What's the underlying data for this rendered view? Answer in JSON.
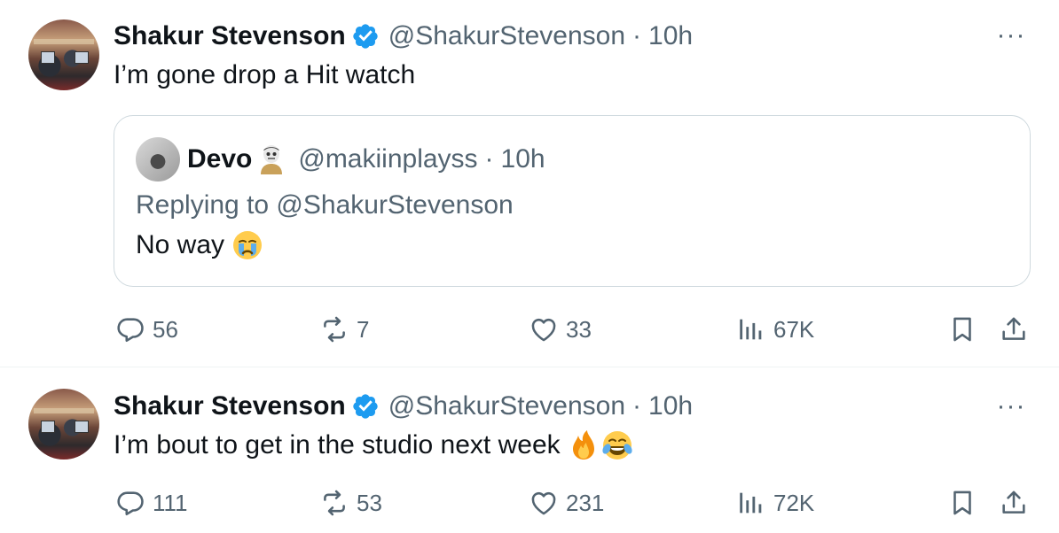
{
  "tweets": [
    {
      "author": {
        "name": "Shakur Stevenson",
        "handle": "@ShakurStevenson"
      },
      "separator": "·",
      "time": "10h",
      "text": "I’m gone drop a Hit watch",
      "more_label": "···",
      "quote": {
        "author": {
          "name": "Devo",
          "handle": "@makiinplayss"
        },
        "separator": "·",
        "time": "10h",
        "replying_to": "Replying to @ShakurStevenson",
        "text": "No way",
        "text_emoji": "loudly-crying-face"
      },
      "stats": {
        "replies": "56",
        "reposts": "7",
        "likes": "33",
        "views": "67K"
      }
    },
    {
      "author": {
        "name": "Shakur Stevenson",
        "handle": "@ShakurStevenson"
      },
      "separator": "·",
      "time": "10h",
      "text": "I’m bout to get in the studio next week",
      "text_emojis": [
        "fire",
        "face-with-tears-of-joy"
      ],
      "more_label": "···",
      "stats": {
        "replies": "111",
        "reposts": "53",
        "likes": "231",
        "views": "72K"
      }
    }
  ],
  "colors": {
    "verified": "#1d9bf0",
    "secondary_text": "#536471",
    "border": "#cfd9de"
  }
}
